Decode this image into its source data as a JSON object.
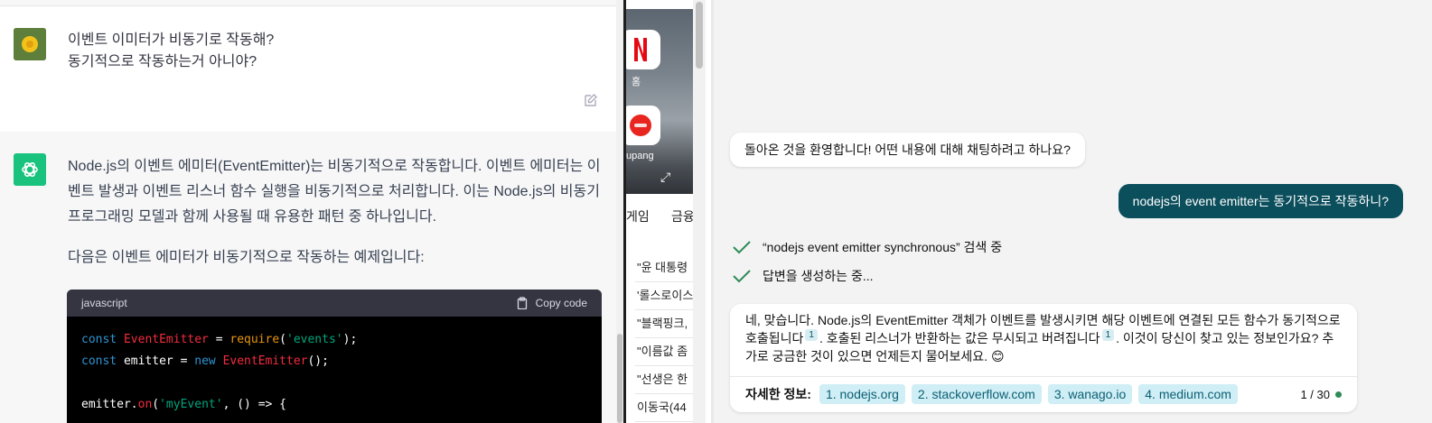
{
  "chatgpt": {
    "user_message": "이벤트 이미터가 비동기로 작동해?\n동기적으로 작동하는거 아니야?",
    "assistant_paragraph1": "Node.js의 이벤트 에미터(EventEmitter)는 비동기적으로 작동합니다. 이벤트 에미터는 이벤트 발생과 이벤트 리스너 함수 실행을 비동기적으로 처리합니다. 이는 Node.js의 비동기 프로그래밍 모델과 함께 사용될 때 유용한 패턴 중 하나입니다.",
    "assistant_paragraph2": "다음은 이벤트 에미터가 비동기적으로 작동하는 예제입니다:",
    "code": {
      "language": "javascript",
      "copy_label": "Copy code",
      "line1": {
        "kw": "const ",
        "cls": "EventEmitter",
        "op": " = ",
        "fn": "require",
        "p1": "(",
        "str": "'events'",
        "p2": ");"
      },
      "line2": {
        "kw": "const ",
        "id": "emitter",
        "op": " = ",
        "kw2": "new ",
        "cls": "EventEmitter",
        "end": "();"
      },
      "line4": {
        "id": "emitter.",
        "fn": "on",
        "p1": "(",
        "str": "'myEvent'",
        "end": ", () => {"
      }
    }
  },
  "browser": {
    "tiles": [
      {
        "label": "홈"
      },
      {
        "label": "upang"
      }
    ],
    "tabs": [
      "게임",
      "금융"
    ],
    "news": [
      "\"윤 대통령",
      "'롤스로이스",
      "\"블랙핑크,",
      "\"이름값 좀",
      "\"선생은 한",
      "이동국(44"
    ]
  },
  "bing": {
    "welcome": "돌아온 것을 환영합니다! 어떤 내용에 대해 채팅하려고 하나요?",
    "user_question": "nodejs의 event emitter는 동기적으로 작동하니?",
    "status_search": "“nodejs event emitter synchronous” 검색 중",
    "status_generate": "답변을 생성하는 중...",
    "answer_part1": "네, 맞습니다. Node.js의 EventEmitter 객체가 이벤트를 발생시키면 해당 이벤트에 연결된 모든 함수가 동기적으로 호출됩니다",
    "ref1": "1",
    "answer_part2": ". 호출된 리스너가 반환하는 값은 무시되고 버려집니다",
    "ref2": "1",
    "answer_part3": ". 이것이 당신이 찾고 있는 정보인가요? 추가로 궁금한 것이 있으면 언제든지 물어보세요. 😊",
    "sources_label": "자세한 정보:",
    "sources": [
      "1. nodejs.org",
      "2. stackoverflow.com",
      "3. wanago.io",
      "4. medium.com"
    ],
    "counter": "1 / 30",
    "colors": {
      "user_bubble": "#0b4e5c",
      "chip_bg": "#cfeef5",
      "check": "#2e8b57"
    }
  }
}
